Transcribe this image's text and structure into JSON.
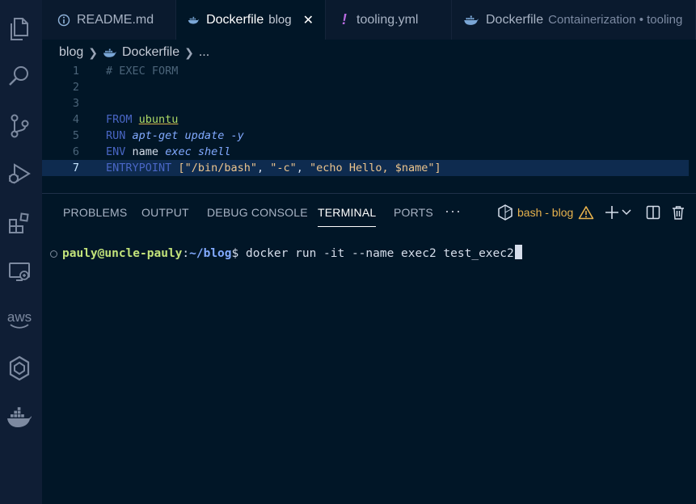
{
  "tabs": [
    {
      "label": "README.md",
      "icon": "info-icon"
    },
    {
      "label": "Dockerfile",
      "description": "blog",
      "icon": "docker-icon",
      "active": true
    },
    {
      "label": "tooling.yml",
      "icon": "exclamation-icon"
    },
    {
      "label": "Dockerfile",
      "description": "Containerization • tooling",
      "icon": "docker-icon"
    }
  ],
  "breadcrumb": {
    "folder": "blog",
    "file": "Dockerfile",
    "more": "..."
  },
  "editor": {
    "lines": [
      {
        "n": "1",
        "t": "# EXEC FORM"
      },
      {
        "n": "2",
        "t": ""
      },
      {
        "n": "3",
        "t": ""
      },
      {
        "n": "4",
        "kw": "FROM",
        "val": "ubuntu"
      },
      {
        "n": "5",
        "kw": "RUN",
        "val": "apt-get update -y"
      },
      {
        "n": "6",
        "kw": "ENV",
        "name": "name",
        "val": "exec shell"
      },
      {
        "n": "7",
        "kw": "ENTRYPOINT",
        "open": "[",
        "a": "\"/bin/bash\"",
        "b": "\"-c\"",
        "c": "\"echo Hello, $name\"",
        "close": "]",
        "comma": ","
      }
    ],
    "current_line": 7
  },
  "panel": {
    "tabs": [
      "PROBLEMS",
      "OUTPUT",
      "DEBUG CONSOLE",
      "TERMINAL",
      "PORTS"
    ],
    "active_tab": "TERMINAL",
    "more": "···",
    "terminal_name": "bash - blog",
    "warning_color": "#e7b24d"
  },
  "terminal": {
    "user": "pauly@uncle-pauly",
    "colon": ":",
    "path": "~/blog",
    "prompt": "$",
    "command": " docker run -it --name exec2 test_exec2"
  },
  "activity_icons": [
    "explorer-icon",
    "search-icon",
    "source-control-icon",
    "run-debug-icon",
    "extensions-icon",
    "remote-explorer-icon",
    "aws-icon",
    "kubernetes-icon",
    "docker-icon"
  ],
  "activity_aws_text": "aws",
  "colors": {
    "background": "#011627",
    "sidebar": "#0f1e35",
    "keyword": "#4966c4",
    "string": "#ecc48d"
  }
}
